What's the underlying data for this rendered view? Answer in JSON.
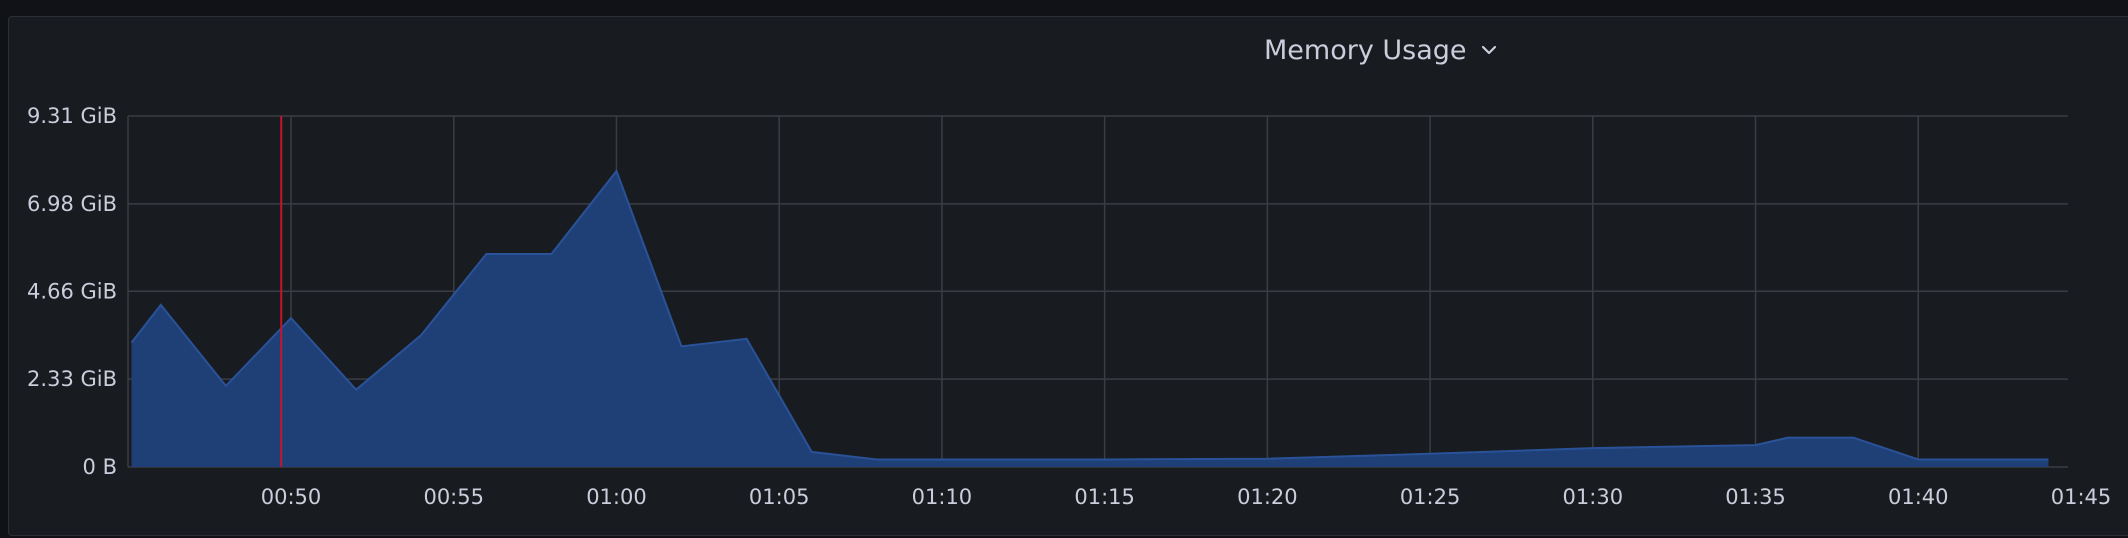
{
  "panel": {
    "title": "Memory Usage"
  },
  "icons": {
    "title_menu": "chevron-down-icon"
  },
  "colors": {
    "background": "#111217",
    "panel": "#181b1f",
    "grid": "#3a3d44",
    "series_fill": "#1f3f77",
    "series_line": "#2a5298",
    "text": "#ccccdc",
    "annotation": "#c4162a"
  },
  "chart_data": {
    "type": "area",
    "title": "Memory Usage",
    "x_unit": "time",
    "y_unit": "GiB",
    "y_ticks": [
      {
        "value": 0,
        "label": "0 B"
      },
      {
        "value": 2.33,
        "label": "2.33 GiB"
      },
      {
        "value": 4.66,
        "label": "4.66 GiB"
      },
      {
        "value": 6.98,
        "label": "6.98 GiB"
      },
      {
        "value": 9.31,
        "label": "9.31 GiB"
      }
    ],
    "x_ticks": [
      "00:50",
      "00:55",
      "01:00",
      "01:05",
      "01:10",
      "01:15",
      "01:20",
      "01:25",
      "01:30",
      "01:35",
      "01:40",
      "01:45"
    ],
    "x_tick_minutes": [
      50,
      55,
      60,
      65,
      70,
      75,
      80,
      85,
      90,
      95,
      100,
      105
    ],
    "xlim_minutes": [
      45.1,
      105
    ],
    "ylim": [
      0,
      9.31
    ],
    "grid": true,
    "legend": "none",
    "annotation_time": "00:49.7",
    "annotation_minute": 49.7,
    "series": [
      {
        "points": [
          [
            45.1,
            3.3
          ],
          [
            46,
            4.3
          ],
          [
            48,
            2.15
          ],
          [
            50,
            3.95
          ],
          [
            52,
            2.05
          ],
          [
            54,
            3.5
          ],
          [
            56,
            5.65
          ],
          [
            58,
            5.65
          ],
          [
            60,
            7.85
          ],
          [
            62,
            3.2
          ],
          [
            64,
            3.4
          ],
          [
            66,
            0.4
          ],
          [
            68,
            0.2
          ],
          [
            70,
            0.2
          ],
          [
            75,
            0.2
          ],
          [
            80,
            0.22
          ],
          [
            85,
            0.35
          ],
          [
            90,
            0.5
          ],
          [
            95,
            0.58
          ],
          [
            96,
            0.78
          ],
          [
            98,
            0.78
          ],
          [
            100,
            0.2
          ],
          [
            104,
            0.2
          ]
        ]
      }
    ]
  }
}
